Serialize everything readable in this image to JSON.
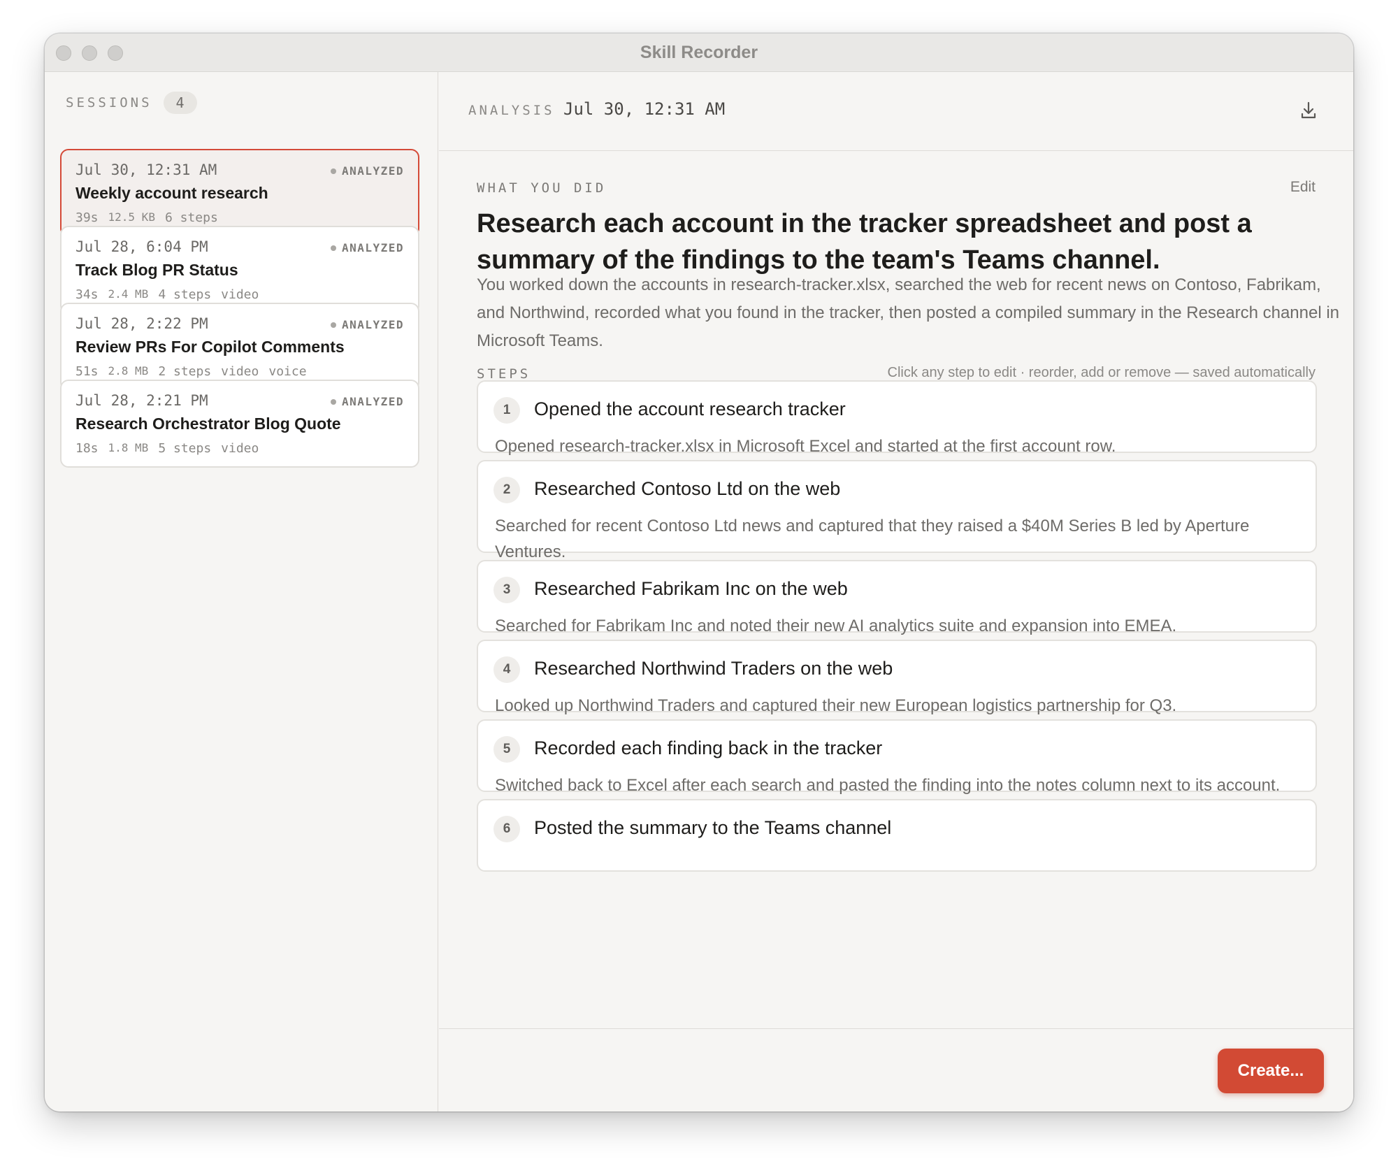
{
  "window": {
    "title": "Skill Recorder"
  },
  "sidebar": {
    "sessions_label": "SESSIONS",
    "sessions_count": "4",
    "sessions": [
      {
        "date": "Jul 30, 12:31 AM",
        "status": "ANALYZED",
        "title": "Weekly account research",
        "duration": "39s",
        "size": "12.5 KB",
        "steps": "6 steps",
        "media": []
      },
      {
        "date": "Jul 28, 6:04 PM",
        "status": "ANALYZED",
        "title": "Track Blog PR Status",
        "duration": "34s",
        "size": "2.4 MB",
        "steps": "4 steps",
        "media": [
          "video"
        ]
      },
      {
        "date": "Jul 28, 2:22 PM",
        "status": "ANALYZED",
        "title": "Review PRs For Copilot Comments",
        "duration": "51s",
        "size": "2.8 MB",
        "steps": "2 steps",
        "media": [
          "video",
          "voice"
        ]
      },
      {
        "date": "Jul 28, 2:21 PM",
        "status": "ANALYZED",
        "title": "Research Orchestrator Blog Quote",
        "duration": "18s",
        "size": "1.8 MB",
        "steps": "5 steps",
        "media": [
          "video"
        ]
      }
    ]
  },
  "analysis": {
    "label": "ANALYSIS",
    "date": "Jul 30, 12:31 AM",
    "download_icon": "download-icon"
  },
  "what_you_did": {
    "label": "WHAT YOU DID",
    "edit_label": "Edit",
    "headline": "Research each account in the tracker spreadsheet and post a summary of the findings to the team's Teams channel.",
    "summary": "You worked down the accounts in research-tracker.xlsx, searched the web for recent news on Contoso, Fabrikam, and Northwind, recorded what you found in the tracker, then posted a compiled summary in the Research channel in Microsoft Teams."
  },
  "steps": {
    "label": "STEPS",
    "hint": "Click any step to edit · reorder, add or remove — saved automatically",
    "items": [
      {
        "num": "1",
        "title": "Opened the account research tracker",
        "desc": "Opened research-tracker.xlsx in Microsoft Excel and started at the first account row."
      },
      {
        "num": "2",
        "title": "Researched Contoso Ltd on the web",
        "desc": "Searched for recent Contoso Ltd news and captured that they raised a $40M Series B led by Aperture Ventures."
      },
      {
        "num": "3",
        "title": "Researched Fabrikam Inc on the web",
        "desc": "Searched for Fabrikam Inc and noted their new AI analytics suite and expansion into EMEA."
      },
      {
        "num": "4",
        "title": "Researched Northwind Traders on the web",
        "desc": "Looked up Northwind Traders and captured their new European logistics partnership for Q3."
      },
      {
        "num": "5",
        "title": "Recorded each finding back in the tracker",
        "desc": "Switched back to Excel after each search and pasted the finding into the notes column next to its account."
      },
      {
        "num": "6",
        "title": "Posted the summary to the Teams channel",
        "desc": ""
      }
    ]
  },
  "footer": {
    "create_label": "Create..."
  },
  "colors": {
    "accent": "#d24a34",
    "selected_border": "#d44a38"
  }
}
